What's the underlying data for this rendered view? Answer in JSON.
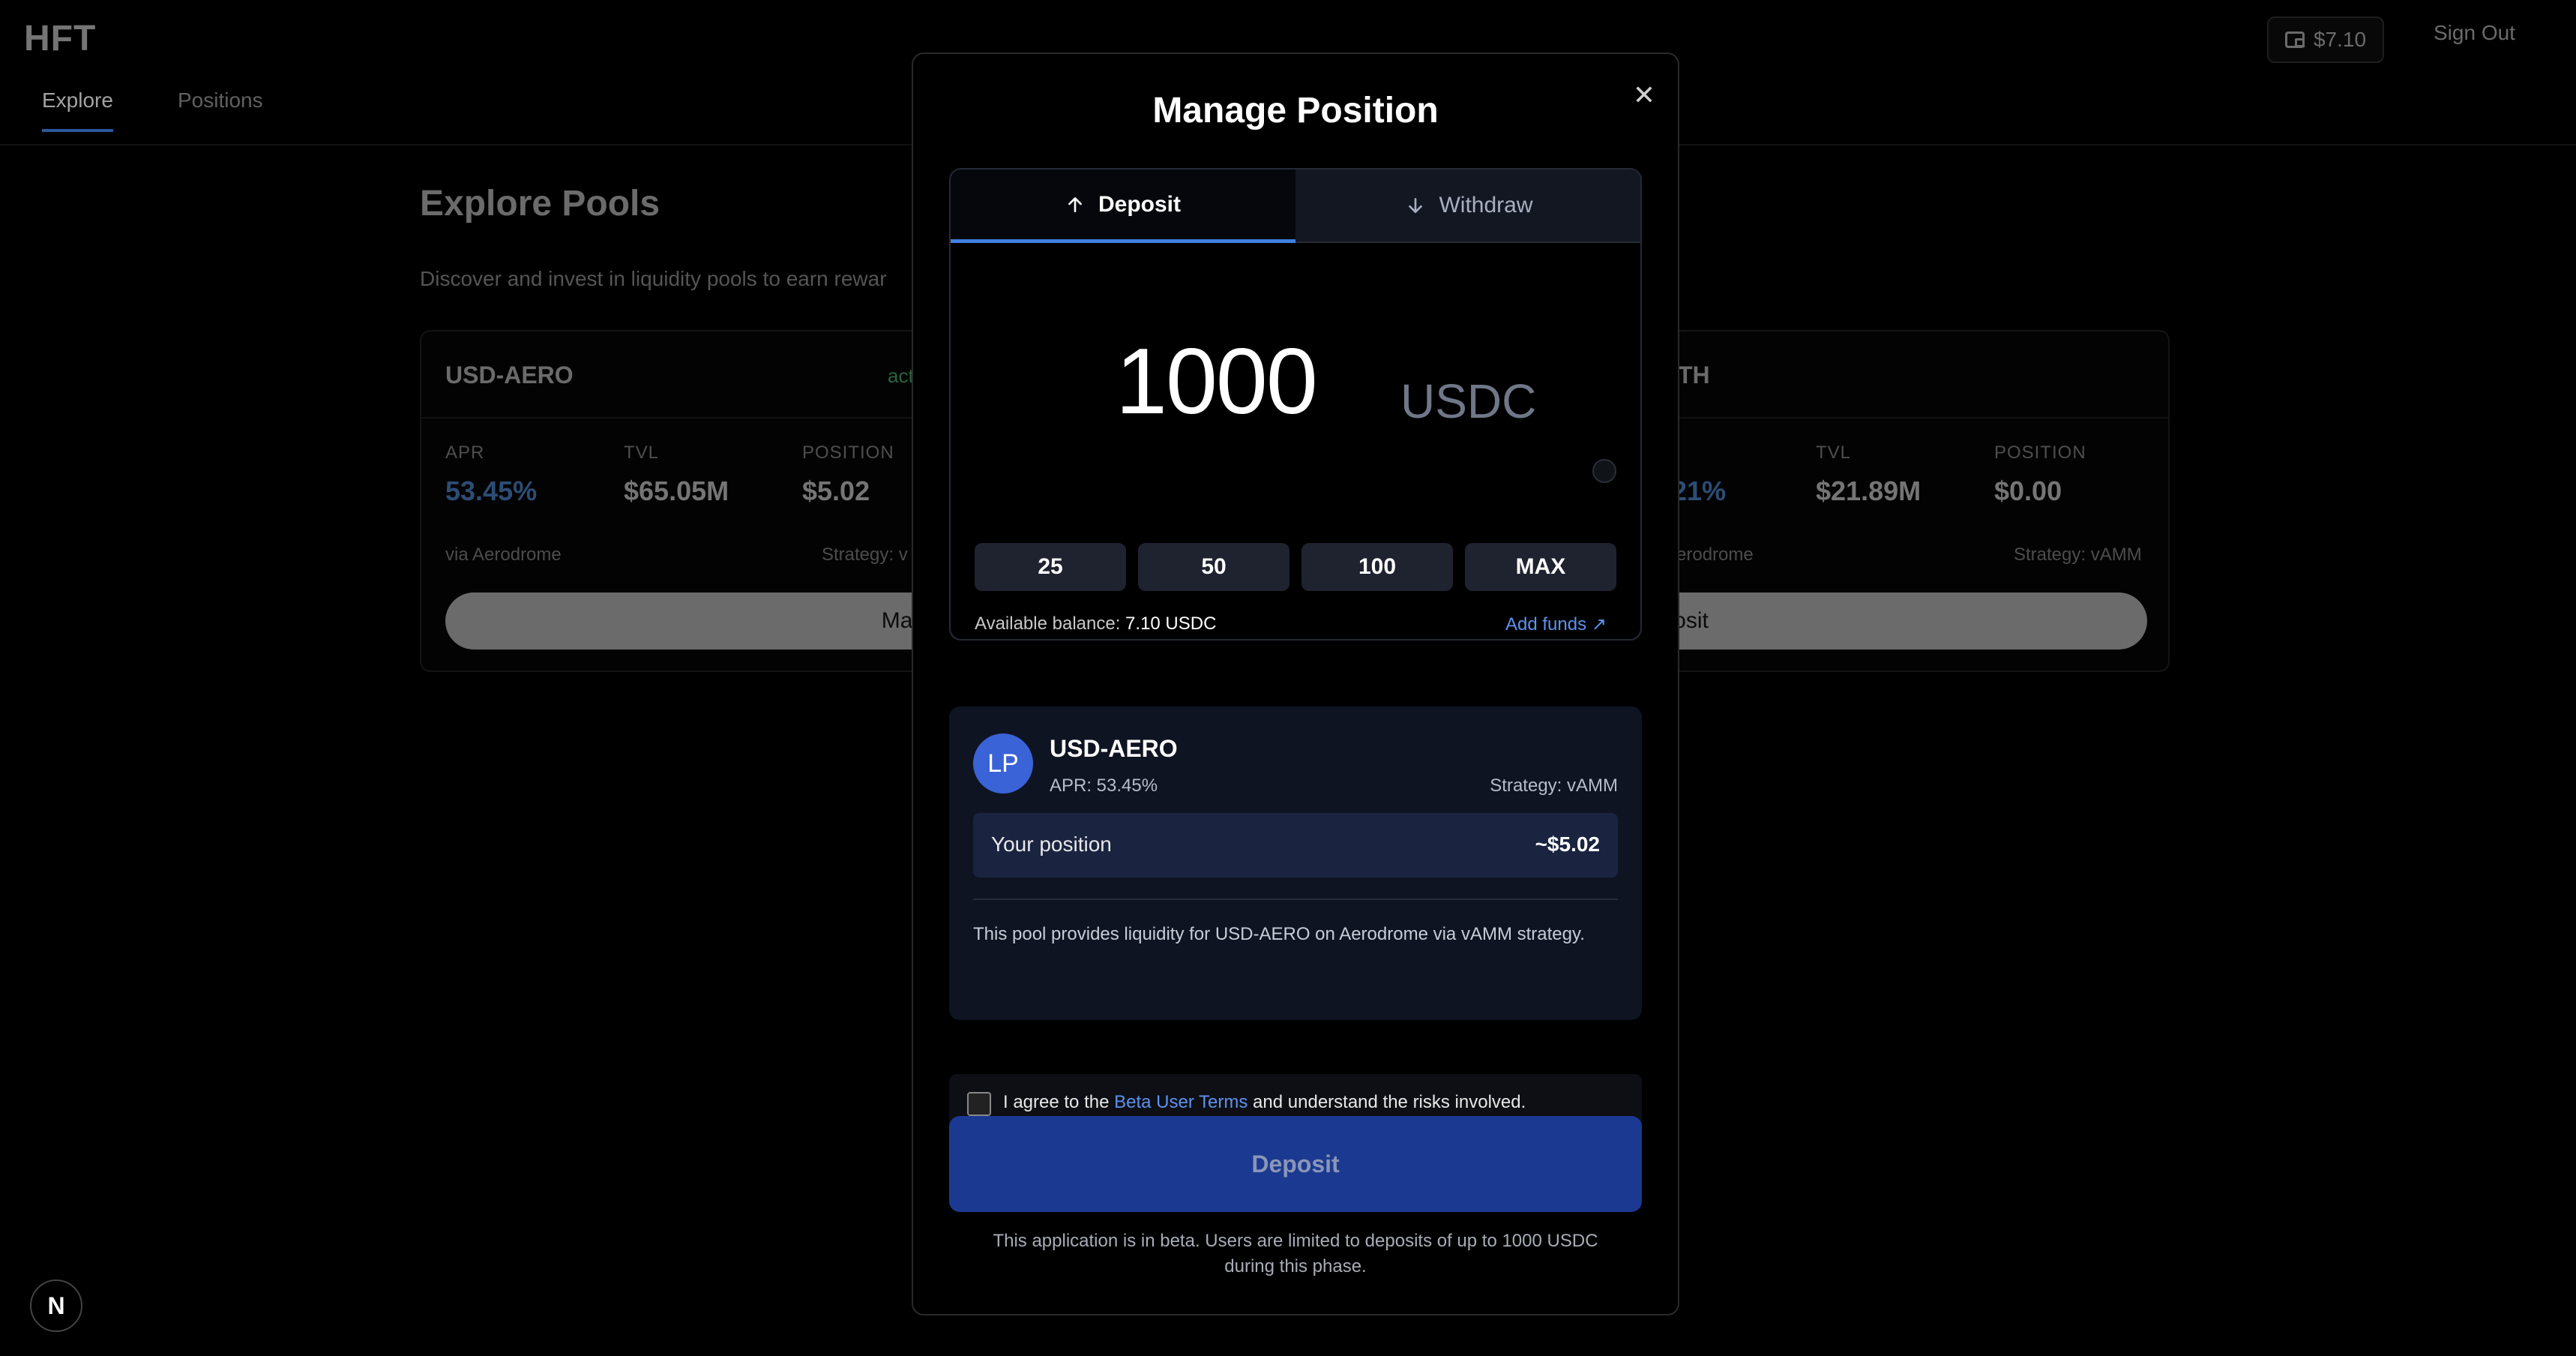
{
  "header": {
    "logo": "HFT",
    "tabs": [
      {
        "label": "Explore"
      },
      {
        "label": "Positions"
      }
    ],
    "wallet_balance": "$7.10",
    "sign_out": "Sign Out"
  },
  "page": {
    "title": "Explore Pools",
    "subtitle": "Discover and invest in liquidity pools to earn rewar"
  },
  "pools": [
    {
      "name": "USD-AERO",
      "status": "act",
      "apr_label": "APR",
      "apr": "53.45%",
      "tvl_label": "TVL",
      "tvl": "$65.05M",
      "position_label": "POSITION",
      "position": "$5.02",
      "source": "via Aerodrome",
      "strategy": "Strategy: v",
      "button": "Manage"
    },
    {
      "name": "-ETH",
      "apr": "21%",
      "tvl_label": "TVL",
      "tvl": "$21.89M",
      "position_label": "POSITION",
      "position": "$0.00",
      "source": "erodrome",
      "strategy": "Strategy: vAMM",
      "button": "Deposit"
    }
  ],
  "modal": {
    "title": "Manage Position",
    "tabs": {
      "deposit": "Deposit",
      "withdraw": "Withdraw"
    },
    "amount": "1000",
    "currency": "USDC",
    "presets": [
      "25",
      "50",
      "100",
      "MAX"
    ],
    "balance_label": "Available balance:",
    "balance_value": "7.10 USDC",
    "add_funds": "Add funds ↗",
    "pool": {
      "avatar": "LP",
      "name": "USD-AERO",
      "apr": "APR: 53.45%",
      "strategy": "Strategy: vAMM",
      "position_label": "Your position",
      "position_value": "~$5.02",
      "description": "This pool provides liquidity for USD-AERO on Aerodrome via vAMM strategy."
    },
    "terms": {
      "prefix": "I agree to the ",
      "link": "Beta User Terms",
      "suffix": " and understand the risks involved."
    },
    "deposit_button": "Deposit",
    "beta_note_line1": "This application is in beta. Users are limited to deposits of up to 1000 USDC",
    "beta_note_line2": "during this phase."
  },
  "corner_badge": "N"
}
